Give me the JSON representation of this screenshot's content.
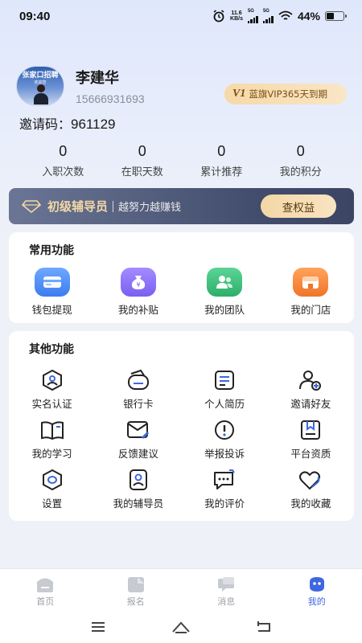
{
  "status_bar": {
    "time": "09:40",
    "net_speed_value": "11.6",
    "net_speed_unit": "KB/s",
    "signal1_label": "5G",
    "signal2_label": "5G",
    "battery": "44%"
  },
  "profile": {
    "avatar_title": "张家口招聘",
    "avatar_sub": "欢迎您",
    "name": "李建华",
    "phone": "15666931693",
    "vip_mark": "V1",
    "vip_text": "蓝旗VIP365天到期",
    "invite_label": "邀请码：",
    "invite_code": "961129"
  },
  "stats": [
    {
      "value": "0",
      "label": "入职次数"
    },
    {
      "value": "0",
      "label": "在职天数"
    },
    {
      "value": "0",
      "label": "累计推荐"
    },
    {
      "value": "0",
      "label": "我的积分"
    }
  ],
  "tutor": {
    "level": "初级辅导员",
    "slogan": "越努力越赚钱",
    "button": "查权益"
  },
  "common_functions": {
    "title": "常用功能",
    "items": [
      {
        "label": "钱包提现",
        "icon": "wallet-icon",
        "color": "#4f8ef6"
      },
      {
        "label": "我的补贴",
        "icon": "money-bag-icon",
        "color": "#8a6ff0"
      },
      {
        "label": "我的团队",
        "icon": "team-icon",
        "color": "#3ebf7e"
      },
      {
        "label": "我的门店",
        "icon": "store-icon",
        "color": "#f58a3c"
      }
    ]
  },
  "other_functions": {
    "title": "其他功能",
    "items": [
      {
        "label": "实名认证",
        "icon": "id-verify-icon"
      },
      {
        "label": "银行卡",
        "icon": "bank-card-icon"
      },
      {
        "label": "个人简历",
        "icon": "resume-icon"
      },
      {
        "label": "邀请好友",
        "icon": "invite-friend-icon"
      },
      {
        "label": "我的学习",
        "icon": "book-icon"
      },
      {
        "label": "反馈建议",
        "icon": "feedback-icon"
      },
      {
        "label": "举报投诉",
        "icon": "report-icon"
      },
      {
        "label": "平台资质",
        "icon": "qualification-icon"
      },
      {
        "label": "设置",
        "icon": "settings-icon"
      },
      {
        "label": "我的辅导员",
        "icon": "tutor-icon"
      },
      {
        "label": "我的评价",
        "icon": "review-icon"
      },
      {
        "label": "我的收藏",
        "icon": "favorite-icon"
      }
    ]
  },
  "tabbar": [
    {
      "label": "首页",
      "icon": "home-icon",
      "active": false
    },
    {
      "label": "报名",
      "icon": "signup-icon",
      "active": false
    },
    {
      "label": "消息",
      "icon": "message-icon",
      "active": false
    },
    {
      "label": "我的",
      "icon": "profile-icon",
      "active": true
    }
  ],
  "colors": {
    "accent": "#3e68e0",
    "gold": "#f3d9a4",
    "banner_dark": "#434d6c"
  }
}
